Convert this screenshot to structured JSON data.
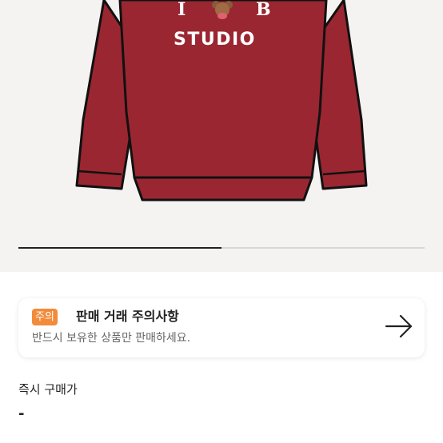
{
  "product": {
    "logo_letters": [
      "I",
      "B"
    ],
    "logo_text": "STUDIO",
    "image_bg_color": "#f4f3f2",
    "sweatshirt_color": "#9a2631",
    "slider_progress": 0.5
  },
  "notice": {
    "badge": "주의",
    "title": "판매 거래 주의사항",
    "subtitle": "반드시 보유한 상품만 판매하세요.",
    "badge_color": "#f28b3a",
    "arrow_icon": "arrow-right-icon"
  },
  "price": {
    "label": "즉시 구매가",
    "value": "-"
  }
}
